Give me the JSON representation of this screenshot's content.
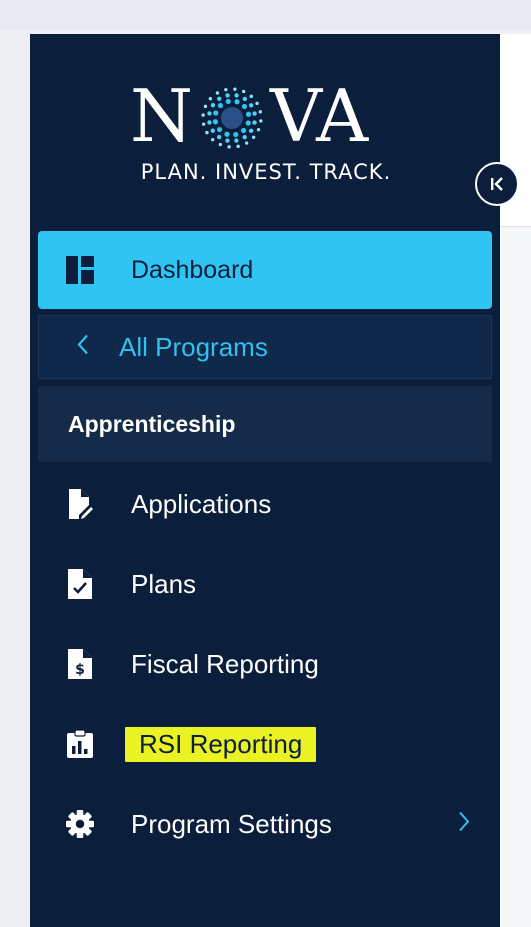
{
  "brand": {
    "logo_text": "NOVA",
    "tagline": "PLAN. INVEST. TRACK.",
    "accent_color": "#2fc4f2",
    "background_color": "#0b1e3b",
    "highlight_color": "#ebf224"
  },
  "collapse_button": {
    "icon": "collapse-left-icon"
  },
  "nav": {
    "dashboard": {
      "label": "Dashboard",
      "icon": "dashboard-icon"
    },
    "all_programs": {
      "label": "All Programs",
      "icon": "chevron-left-icon"
    },
    "section_title": "Apprenticeship",
    "items": [
      {
        "label": "Applications",
        "icon": "edit-document-icon"
      },
      {
        "label": "Plans",
        "icon": "check-document-icon"
      },
      {
        "label": "Fiscal Reporting",
        "icon": "dollar-document-icon"
      },
      {
        "label": "RSI Reporting",
        "icon": "clipboard-chart-icon"
      },
      {
        "label": "Program Settings",
        "icon": "gear-icon"
      }
    ]
  }
}
